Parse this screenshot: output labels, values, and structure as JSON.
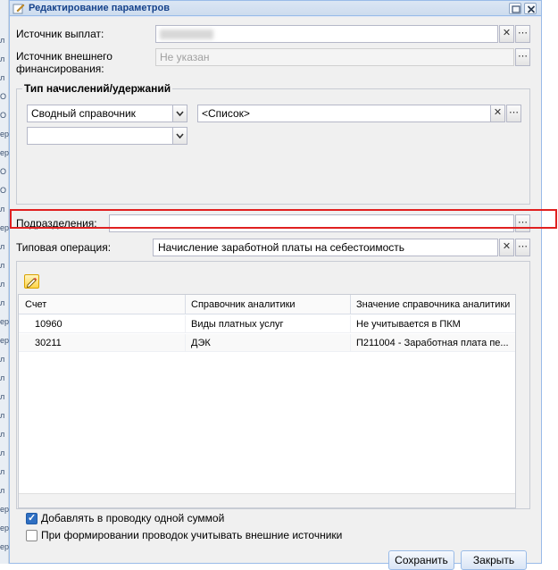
{
  "window": {
    "title": "Редактирование параметров"
  },
  "form": {
    "source_label": "Источник выплат:",
    "source_value": "",
    "ext_source_label_line1": "Источник внешнего",
    "ext_source_label_line2": "финансирования:",
    "ext_source_value": "Не указан",
    "accruals_legend": "Тип начислений/удержаний",
    "accruals_select": "Сводный справочник",
    "accruals_list": "<Список>",
    "accruals_select2": "",
    "dept_label": "Подразделения:",
    "dept_value": "",
    "operation_label": "Типовая операция:",
    "operation_value": "Начисление заработной платы на себестоимость"
  },
  "table": {
    "columns": [
      "Счет",
      "Справочник аналитики",
      "Значение справочника аналитики"
    ],
    "rows": [
      [
        "10960",
        "Виды платных услуг",
        "Не учитывается в ПКМ"
      ],
      [
        "30211",
        "ДЭК",
        "П211004 - Заработная плата пе..."
      ]
    ]
  },
  "options": {
    "single_sum_label": "Добавлять в проводку одной суммой",
    "single_sum_checked": true,
    "ext_sources_label": "При формировании проводок учитывать внешние источники",
    "ext_sources_checked": false
  },
  "buttons": {
    "save": "Сохранить",
    "close": "Закрыть"
  },
  "background_strip": [
    "л",
    "л",
    "л",
    "О",
    "О",
    "ер",
    "ер",
    "О",
    "О",
    "л",
    "ер",
    "л",
    "л",
    "л",
    "л",
    "ер",
    "ер",
    "л",
    "л",
    "л",
    "л",
    "л",
    "л",
    "л",
    "л",
    "ер",
    "ер",
    "ер"
  ],
  "colors": {
    "accent": "#15428b",
    "highlight": "#e02020",
    "checkbox": "#2f6fc2"
  }
}
